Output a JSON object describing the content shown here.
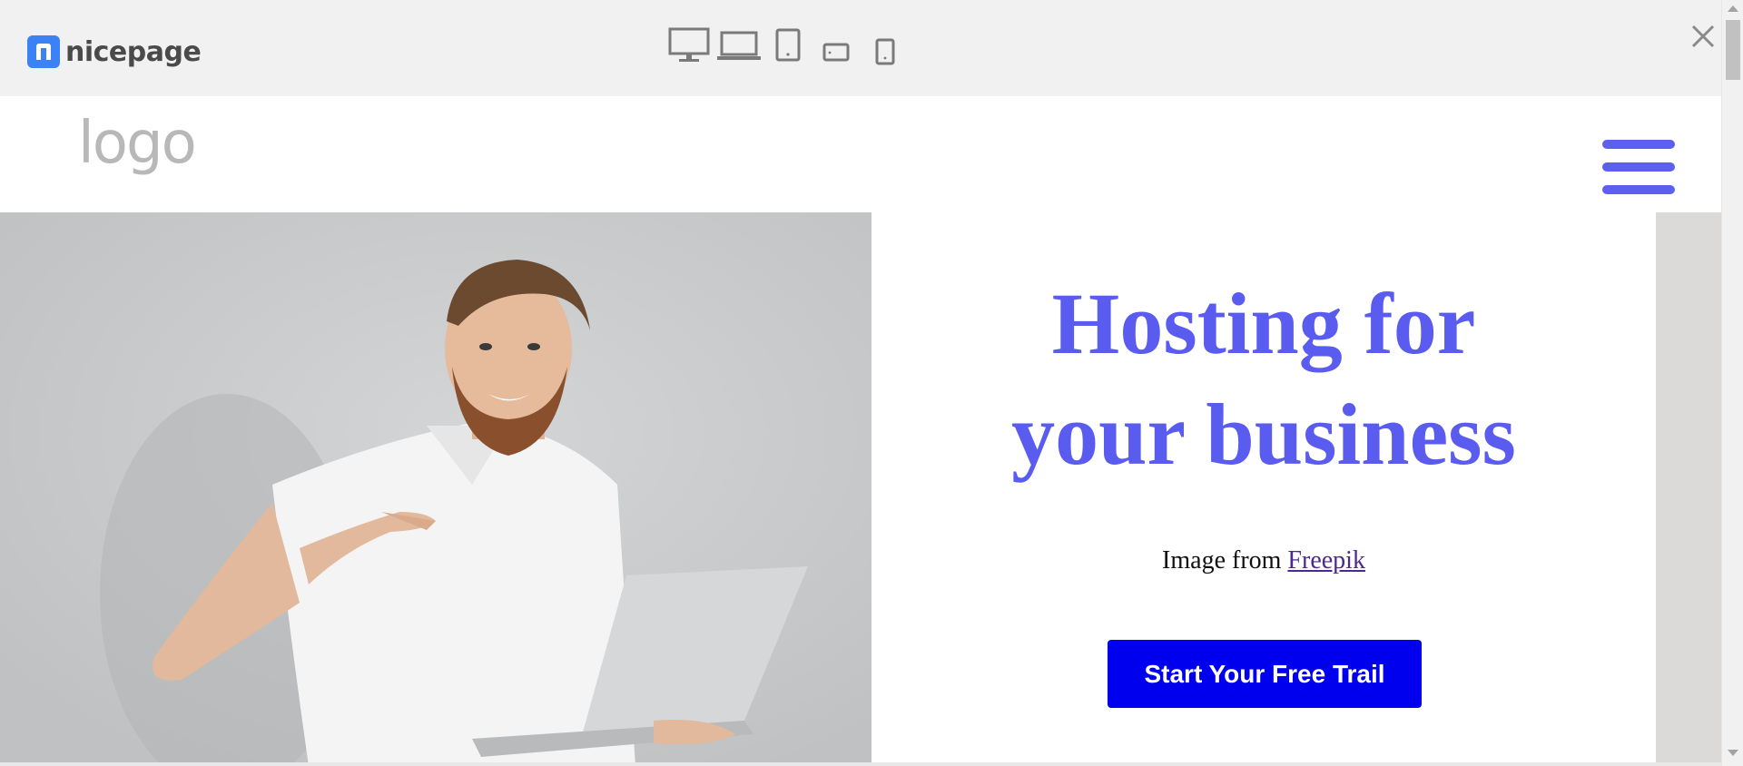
{
  "toolbar": {
    "brand_name": "nicepage",
    "devices": [
      "desktop-icon",
      "laptop-icon",
      "tablet-portrait-icon",
      "tablet-landscape-icon",
      "phone-icon"
    ],
    "close_icon": "close-icon"
  },
  "site": {
    "logo_text": "logo",
    "menu_icon": "hamburger-menu-icon",
    "accent_color": "#5a5cf0"
  },
  "hero": {
    "title_line1": "Hosting for",
    "title_line2": "your business",
    "credit_prefix": "Image from ",
    "credit_link": "Freepik",
    "cta_label": "Start Your Free Trail",
    "cta_color": "#0000ee"
  }
}
